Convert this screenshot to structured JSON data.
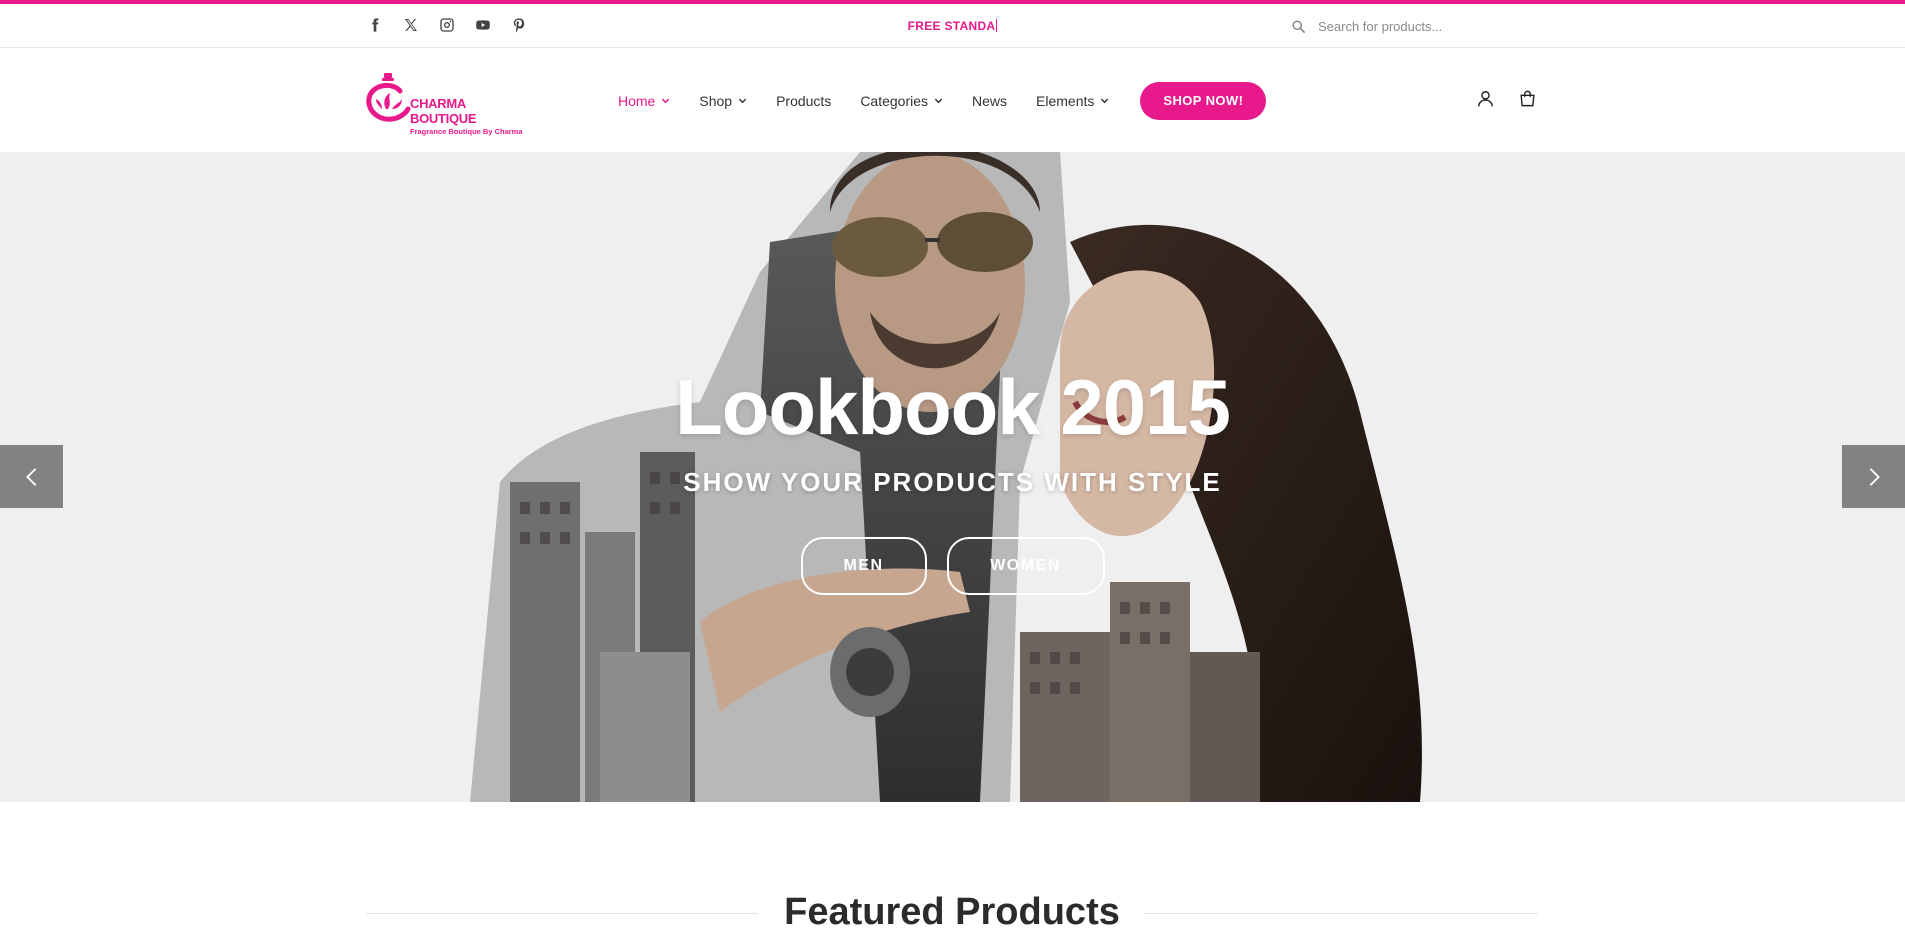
{
  "topbar": {
    "promo": "FREE STANDA",
    "search_placeholder": "Search for products...",
    "social": [
      "facebook-icon",
      "x-icon",
      "instagram-icon",
      "youtube-icon",
      "pinterest-icon"
    ]
  },
  "logo": {
    "title": "CHARMA BOUTIQUE",
    "subtitle": "Fragrance Boutique By Charma"
  },
  "nav": {
    "items": [
      {
        "label": "Home",
        "dropdown": true,
        "active": true
      },
      {
        "label": "Shop",
        "dropdown": true,
        "active": false
      },
      {
        "label": "Products",
        "dropdown": false,
        "active": false
      },
      {
        "label": "Categories",
        "dropdown": true,
        "active": false
      },
      {
        "label": "News",
        "dropdown": false,
        "active": false
      },
      {
        "label": "Elements",
        "dropdown": true,
        "active": false
      }
    ],
    "cta": "SHOP NOW!"
  },
  "header_icons": [
    "user-icon",
    "cart-icon"
  ],
  "hero": {
    "title": "Lookbook 2015",
    "subtitle": "SHOW YOUR PRODUCTS WITH STYLE",
    "buttons": {
      "men": "MEN",
      "women": "WOMEN"
    }
  },
  "section": {
    "title": "Featured Products"
  },
  "colors": {
    "accent": "#e8198b",
    "hero_bg": "#efefef"
  }
}
